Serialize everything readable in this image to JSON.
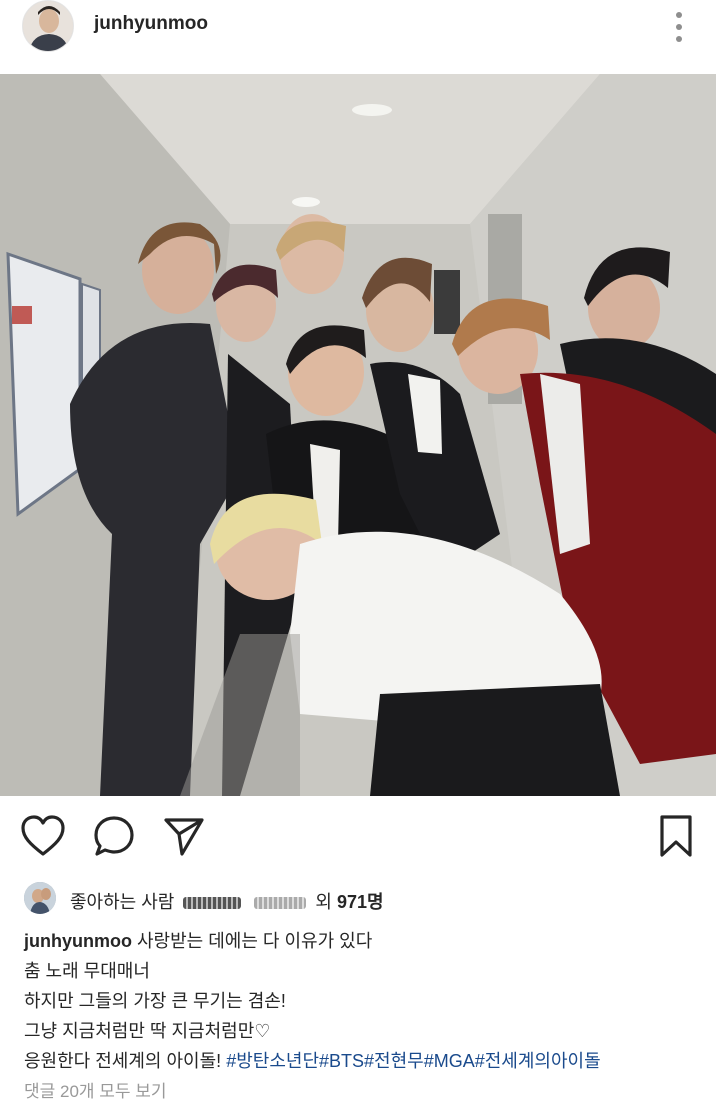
{
  "post": {
    "username": "junhyunmoo"
  },
  "icons": {
    "more": "more-vertical-icon",
    "like": "heart-icon",
    "comment": "comment-bubble-icon",
    "share": "paper-plane-icon",
    "save": "bookmark-icon"
  },
  "likes": {
    "prefix": "좋아하는 사람",
    "suffix": "외",
    "count": "971명"
  },
  "caption": {
    "username": "junhyunmoo",
    "line1": "사랑받는 데에는 다 이유가 있다",
    "line2": "춤 노래 무대매너",
    "line3": "하지만 그들의 가장 큰 무기는 겸손!",
    "line4": "그냥 지금처럼만 딱 지금처럼만♡",
    "line5_text": "응원한다 전세계의 아이돌!",
    "line5_tags": "#방탄소년단#BTS#전현무#MGA#전세계의아이돌"
  },
  "comments": {
    "view_all": "댓글 20개 모두 보기"
  },
  "colors": {
    "text": "#262626",
    "hashtag": "#1a4a8c",
    "muted": "#999999"
  }
}
